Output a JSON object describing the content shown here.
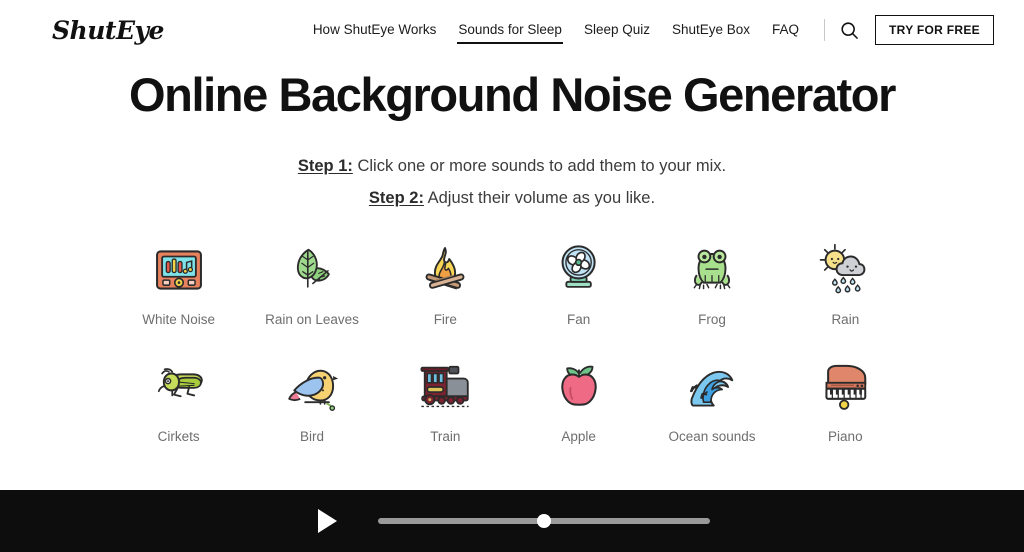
{
  "header": {
    "logo": "ShutEye",
    "nav_items": [
      {
        "label": "How ShutEye Works",
        "active": false
      },
      {
        "label": "Sounds for Sleep",
        "active": true
      },
      {
        "label": "Sleep Quiz",
        "active": false
      },
      {
        "label": "ShutEye Box",
        "active": false
      },
      {
        "label": "FAQ",
        "active": false
      }
    ],
    "search_icon": "search-icon",
    "cta_label": "TRY FOR FREE"
  },
  "main": {
    "title": "Online Background Noise Generator",
    "steps": [
      {
        "key": "Step 1:",
        "text": " Click one or more sounds to add them to your mix."
      },
      {
        "key": "Step 2:",
        "text": " Adjust their volume as you like."
      }
    ],
    "sounds": [
      {
        "label": "White Noise",
        "icon": "white-noise-icon"
      },
      {
        "label": "Rain on Leaves",
        "icon": "leaves-icon"
      },
      {
        "label": "Fire",
        "icon": "fire-icon"
      },
      {
        "label": "Fan",
        "icon": "fan-icon"
      },
      {
        "label": "Frog",
        "icon": "frog-icon"
      },
      {
        "label": "Rain",
        "icon": "rain-cloud-sun-icon"
      },
      {
        "label": "Cirkets",
        "icon": "cricket-icon"
      },
      {
        "label": "Bird",
        "icon": "bird-icon"
      },
      {
        "label": "Train",
        "icon": "train-icon"
      },
      {
        "label": "Apple",
        "icon": "apple-icon"
      },
      {
        "label": "Ocean sounds",
        "icon": "wave-icon"
      },
      {
        "label": "Piano",
        "icon": "piano-icon"
      }
    ]
  },
  "player": {
    "play_icon": "play-icon",
    "volume_percent": 50,
    "background_color": "#0d0d0d",
    "track_color": "#9a9a9a",
    "thumb_color": "#ffffff"
  },
  "colors": {
    "page_background": "#ffffff",
    "text_primary": "#111111",
    "text_muted": "#6e6e6e",
    "accent_border": "#111111"
  }
}
